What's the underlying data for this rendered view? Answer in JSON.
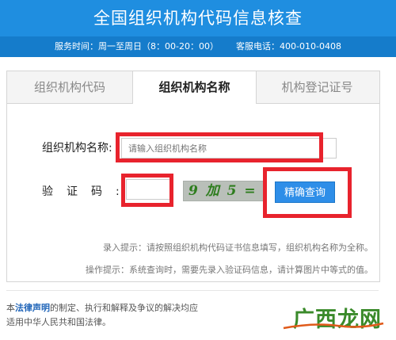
{
  "header": {
    "title": "全国组织机构代码信息核查",
    "service_hours": "服务时间：周一至周日（8：00-20：00）",
    "hotline": "客服电话：400-010-0408"
  },
  "tabs": [
    {
      "label": "组织机构代码"
    },
    {
      "label": "组织机构名称"
    },
    {
      "label": "机构登记证号"
    }
  ],
  "form": {
    "name_label": "组织机构名称:",
    "name_placeholder": "请输入组织机构名称",
    "code_label": "验证码:",
    "captcha_text": "9 加 5 = ?",
    "query_button": "精确查询"
  },
  "hints": {
    "input_hint": "录入提示：请按照组织机构代码证书信息填写，组织机构名称为全称。",
    "operation_hint": "操作提示：系统查询时，需要先录入验证码信息，请计算图片中等式的值。"
  },
  "footer": {
    "prefix": "本",
    "link": "法律声明",
    "line1_rest": "的制定、执行和解释及争议的解决均应",
    "line2": "适用中华人民共和国法律。"
  },
  "watermark": {
    "text": "广西龙网"
  },
  "colors": {
    "header_bg": "#1f8ee0",
    "subbar_bg": "#157ccb",
    "button_bg": "#2e8ee8",
    "highlight": "#e8232d",
    "captcha_text": "#2e7d1e"
  }
}
